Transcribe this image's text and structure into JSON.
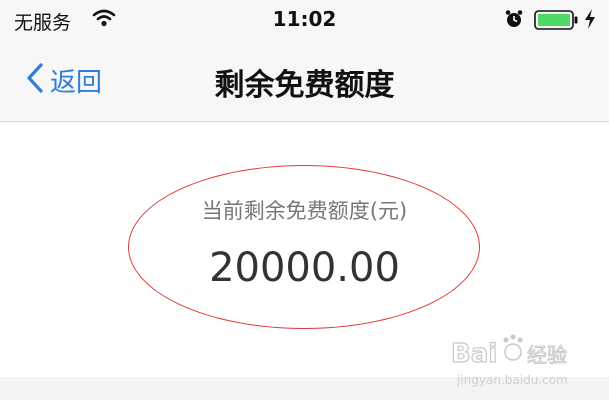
{
  "status_bar": {
    "carrier": "无服务",
    "time": "11:02",
    "icons": [
      "wifi-icon",
      "alarm-icon",
      "battery-icon",
      "charging-icon"
    ],
    "battery_color": "#4cd964"
  },
  "nav": {
    "back_label": "返回",
    "title": "剩余免费额度",
    "accent_color": "#2f7fd6"
  },
  "quota": {
    "label": "当前剩余免费额度(元)",
    "value": "20000.00",
    "highlight_color": "#e03a3a"
  },
  "watermark": {
    "brand": "Bai",
    "suffix": "经验",
    "url": "jingyan.baidu.com"
  }
}
